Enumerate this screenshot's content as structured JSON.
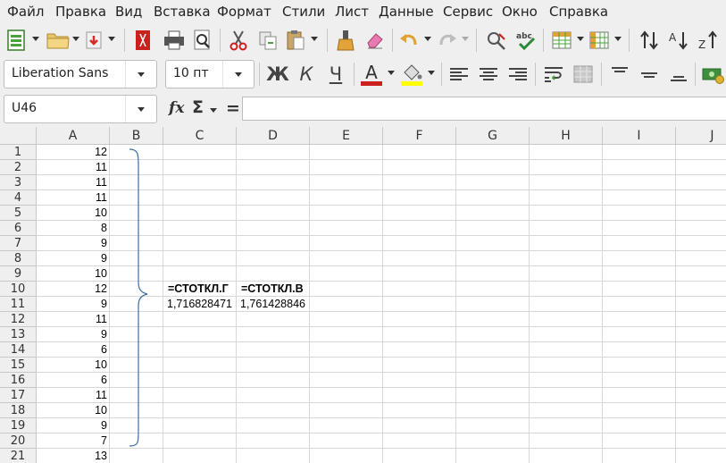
{
  "menu": [
    "Файл",
    "Правка",
    "Вид",
    "Вставка",
    "Формат",
    "Стили",
    "Лист",
    "Данные",
    "Сервис",
    "Окно",
    "Справка"
  ],
  "font": {
    "name": "Liberation Sans",
    "size": "10 пт"
  },
  "format_buttons": {
    "bold": "Ж",
    "italic": "К",
    "underline": "Ч",
    "font_color": "A"
  },
  "name_box": "U46",
  "formula_bar": {
    "fx": "fx",
    "sum": "Σ",
    "equals": "=",
    "content": ""
  },
  "columns": [
    "A",
    "B",
    "C",
    "D",
    "E",
    "F",
    "G",
    "H",
    "I",
    "J"
  ],
  "rows": [
    "1",
    "2",
    "3",
    "4",
    "5",
    "6",
    "7",
    "8",
    "9",
    "10",
    "11",
    "12",
    "13",
    "14",
    "15",
    "16",
    "17",
    "18",
    "19",
    "20",
    "21"
  ],
  "column_a": [
    "12",
    "11",
    "11",
    "11",
    "10",
    "8",
    "9",
    "9",
    "10",
    "12",
    "9",
    "11",
    "9",
    "6",
    "10",
    "6",
    "11",
    "10",
    "9",
    "7",
    "13"
  ],
  "labels": {
    "c10": "=СТОТКЛ.Г",
    "d10": "=СТОТКЛ.В"
  },
  "values": {
    "c11": "1,716828471",
    "d11": "1,761428846"
  },
  "colors": {
    "accent_red": "#c9211e",
    "highlight_yellow": "#ffff00",
    "grid_line": "#d7d7d7",
    "brace": "#3a6ea5"
  }
}
